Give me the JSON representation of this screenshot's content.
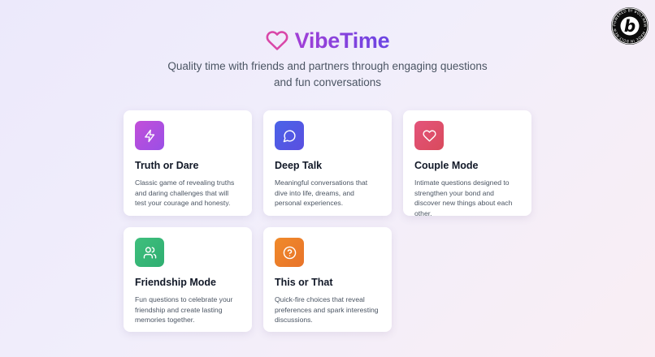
{
  "header": {
    "title": "VibeTime",
    "subtitle": "Quality time with friends and partners through engaging questions and fun conversations"
  },
  "cards": [
    {
      "title": "Truth or Dare",
      "description": "Classic game of revealing truths and daring challenges that will test your courage and honesty.",
      "icon": "lightning-icon",
      "gradient": [
        "#c24fd9",
        "#9a4fe6"
      ]
    },
    {
      "title": "Deep Talk",
      "description": "Meaningful conversations that dive into life, dreams, and personal experiences.",
      "icon": "chat-bubble-icon",
      "gradient": [
        "#4a63e8",
        "#5a4fe0"
      ]
    },
    {
      "title": "Couple Mode",
      "description": "Intimate questions designed to strengthen your bond and discover new things about each other.",
      "icon": "heart-icon",
      "gradient": [
        "#e4547b",
        "#d94a5c"
      ]
    },
    {
      "title": "Friendship Mode",
      "description": "Fun questions to celebrate your friendship and create lasting memories together.",
      "icon": "users-icon",
      "gradient": [
        "#3fbf7d",
        "#2fae71"
      ]
    },
    {
      "title": "This or That",
      "description": "Quick-fire choices that reveal preferences and spark interesting discussions.",
      "icon": "question-circle-icon",
      "gradient": [
        "#f08a2a",
        "#e8732a"
      ]
    }
  ],
  "badge": {
    "letter": "b",
    "ring_text": "POWERED BY BOLT.NEW · MADE IN BOLT.NEW · "
  }
}
